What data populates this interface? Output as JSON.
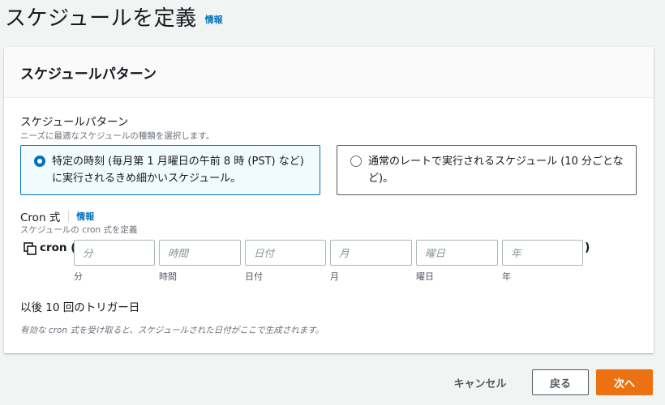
{
  "page": {
    "title": "スケジュールを定義",
    "info_link": "情報"
  },
  "panel": {
    "title": "スケジュールパターン",
    "pattern_label": "スケジュールパターン",
    "pattern_desc": "ニーズに最適なスケジュールの種類を選択します。",
    "options": [
      {
        "label": "特定の時刻 (毎月第 1 月曜日の午前 8 時 (PST) など) に実行されるきめ細かいスケジュール。",
        "selected": true
      },
      {
        "label": "通常のレートで実行されるスケジュール (10 分ごとなど)。",
        "selected": false
      }
    ],
    "cron_label": "Cron 式",
    "cron_info": "情報",
    "cron_desc": "スケジュールの cron 式を定義",
    "cron_prefix": "cron (",
    "cron_suffix": ")",
    "cron_fields": [
      {
        "placeholder": "分",
        "sublabel": "分",
        "value": ""
      },
      {
        "placeholder": "時間",
        "sublabel": "時間",
        "value": ""
      },
      {
        "placeholder": "日付",
        "sublabel": "日付",
        "value": ""
      },
      {
        "placeholder": "月",
        "sublabel": "月",
        "value": ""
      },
      {
        "placeholder": "曜日",
        "sublabel": "曜日",
        "value": ""
      },
      {
        "placeholder": "年",
        "sublabel": "年",
        "value": ""
      }
    ],
    "next_triggers_label": "以後 10 回のトリガー日",
    "next_triggers_hint": "有効な cron 式を受け取ると、スケジュールされた日付がここで生成されます。"
  },
  "footer": {
    "cancel_label": "キャンセル",
    "back_label": "戻る",
    "next_label": "次へ"
  },
  "colors": {
    "accent": "#0073bb",
    "primary_button": "#ec7211",
    "background": "#f2f3f3"
  },
  "icons": {
    "copy": "copy-icon"
  }
}
